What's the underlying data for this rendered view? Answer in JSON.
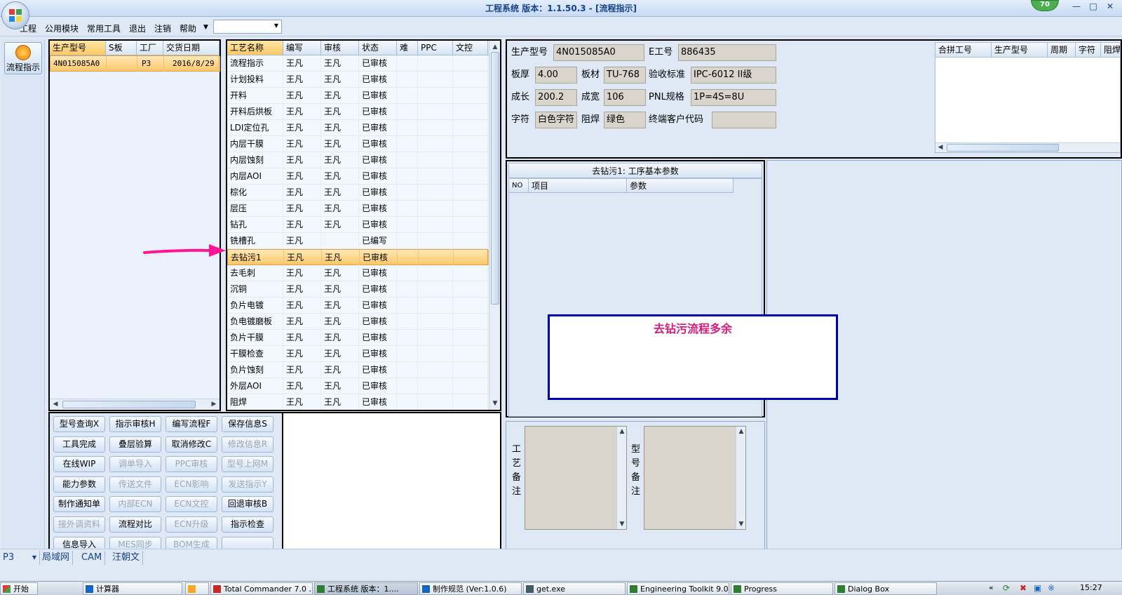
{
  "window": {
    "title": "工程系统  版本：1.1.50.3 - [流程指示]",
    "badge": "70"
  },
  "menu": {
    "items": [
      "工程",
      "公用模块",
      "常用工具",
      "退出",
      "注销",
      "帮助"
    ],
    "combo_value": ""
  },
  "nav": {
    "button_label": "流程指示"
  },
  "orders": {
    "columns": [
      "生产型号",
      "S板",
      "工厂",
      "交货日期"
    ],
    "rows": [
      [
        "4N015085A0",
        "",
        "P3",
        "2016/8/29"
      ]
    ]
  },
  "process": {
    "columns": [
      "工艺名称",
      "编写",
      "审核",
      "状态",
      "难",
      "PPC",
      "文控"
    ],
    "rows": [
      [
        "流程指示",
        "王凡",
        "王凡",
        "已审核"
      ],
      [
        "计划投料",
        "王凡",
        "王凡",
        "已审核"
      ],
      [
        "开料",
        "王凡",
        "王凡",
        "已审核"
      ],
      [
        "开料后烘板",
        "王凡",
        "王凡",
        "已审核"
      ],
      [
        "LDI定位孔",
        "王凡",
        "王凡",
        "已审核"
      ],
      [
        "内层干膜",
        "王凡",
        "王凡",
        "已审核"
      ],
      [
        "内层蚀刻",
        "王凡",
        "王凡",
        "已审核"
      ],
      [
        "内层AOI",
        "王凡",
        "王凡",
        "已审核"
      ],
      [
        "棕化",
        "王凡",
        "王凡",
        "已审核"
      ],
      [
        "层压",
        "王凡",
        "王凡",
        "已审核"
      ],
      [
        "钻孔",
        "王凡",
        "王凡",
        "已审核"
      ],
      [
        "铣槽孔",
        "王凡",
        "",
        "已编写"
      ],
      [
        "去钻污1",
        "王凡",
        "王凡",
        "已审核"
      ],
      [
        "去毛刺",
        "王凡",
        "王凡",
        "已审核"
      ],
      [
        "沉铜",
        "王凡",
        "王凡",
        "已审核"
      ],
      [
        "负片电镀",
        "王凡",
        "王凡",
        "已审核"
      ],
      [
        "负电镀磨板",
        "王凡",
        "王凡",
        "已审核"
      ],
      [
        "负片干膜",
        "王凡",
        "王凡",
        "已审核"
      ],
      [
        "干膜检查",
        "王凡",
        "王凡",
        "已审核"
      ],
      [
        "负片蚀刻",
        "王凡",
        "王凡",
        "已审核"
      ],
      [
        "外层AOI",
        "王凡",
        "王凡",
        "已审核"
      ],
      [
        "阻焊",
        "王凡",
        "王凡",
        "已审核"
      ]
    ],
    "selected_index": 12
  },
  "buttons": [
    {
      "label": "型号查询X",
      "enabled": true
    },
    {
      "label": "指示审核H",
      "enabled": true
    },
    {
      "label": "编写流程F",
      "enabled": true
    },
    {
      "label": "保存信息S",
      "enabled": true
    },
    {
      "label": "工具完成",
      "enabled": true
    },
    {
      "label": "叠层验算",
      "enabled": true
    },
    {
      "label": "取消修改C",
      "enabled": true
    },
    {
      "label": "修改信息R",
      "enabled": false
    },
    {
      "label": "在线WIP",
      "enabled": true
    },
    {
      "label": "调单导入",
      "enabled": false
    },
    {
      "label": "PPC审核",
      "enabled": false
    },
    {
      "label": "型号上网M",
      "enabled": false
    },
    {
      "label": "能力参数",
      "enabled": true
    },
    {
      "label": "传送文件",
      "enabled": false
    },
    {
      "label": "ECN影响",
      "enabled": false
    },
    {
      "label": "发送指示Y",
      "enabled": false
    },
    {
      "label": "制作通知单",
      "enabled": true
    },
    {
      "label": "内部ECN",
      "enabled": false
    },
    {
      "label": "ECN文控",
      "enabled": false
    },
    {
      "label": "回退审核B",
      "enabled": true
    },
    {
      "label": "接外调资料",
      "enabled": false
    },
    {
      "label": "流程对比",
      "enabled": true
    },
    {
      "label": "ECN升级",
      "enabled": false
    },
    {
      "label": "指示检查",
      "enabled": true
    },
    {
      "label": "信息导入",
      "enabled": true
    },
    {
      "label": "MES同步",
      "enabled": false
    },
    {
      "label": "BOM生成",
      "enabled": false
    },
    {
      "label": "",
      "enabled": true
    }
  ],
  "info": {
    "model_label": "生产型号",
    "model_value": "4N015085A0",
    "eno_label": "E工号",
    "eno_value": "886435",
    "thick_label": "板厚",
    "thick_value": "4.00",
    "material_label": "板材",
    "material_value": "TU-768",
    "standard_label": "验收标准",
    "standard_value": "IPC-6012 II级",
    "grow_label": "成长",
    "grow_value": "200.2",
    "width_label": "成宽",
    "width_value": "106",
    "pnl_label": "PNL规格",
    "pnl_value": "1P=4S=8U",
    "char_label": "字符",
    "char_value": "白色字符",
    "mask_label": "阻焊",
    "mask_value": "绿色",
    "client_label": "终端客户代码",
    "client_value": ""
  },
  "merge": {
    "columns": [
      "合拼工号",
      "生产型号",
      "周期",
      "字符",
      "阻焊"
    ]
  },
  "params": {
    "title": "去钻污1: 工序基本参数",
    "columns": [
      "NO",
      "项目",
      "参数"
    ]
  },
  "annotation": {
    "text": "去钻污流程多余",
    "color": "#d81b7a",
    "border": "#0000aa"
  },
  "notes": {
    "process_label": "工艺备注",
    "model_label": "型号备注"
  },
  "bottom": {
    "combo": "P3",
    "tabs": [
      "局域网",
      "CAM",
      "汪朝文"
    ]
  },
  "taskbar": {
    "start": "开始",
    "items": [
      "计算器",
      "",
      "Total Commander 7.0 ...",
      "工程系统  版本：1....",
      "制作规范 (Ver:1.0.6)",
      "get.exe",
      "Engineering Toolkit 9.0...",
      "Progress",
      "Dialog Box"
    ],
    "clock": "15:27"
  },
  "colors": {
    "accent": "#15428b",
    "highlight": "#fcc86d",
    "arrow": "#ff1493"
  }
}
